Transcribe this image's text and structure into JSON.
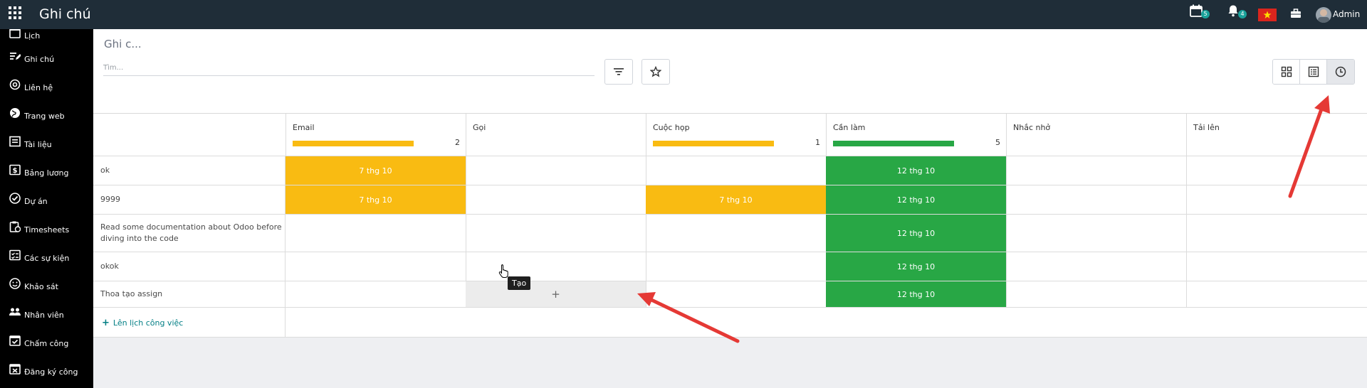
{
  "topbar": {
    "app_title": "Ghi chú",
    "activity_badge": "5",
    "notification_badge": "4",
    "user_name": "Admin"
  },
  "sidebar": {
    "items": [
      {
        "label": "Lịch",
        "icon": "calendar-icon"
      },
      {
        "label": "Ghi chú",
        "icon": "note-icon"
      },
      {
        "label": "Liên hệ",
        "icon": "at-icon"
      },
      {
        "label": "Trang web",
        "icon": "globe-icon"
      },
      {
        "label": "Tài liệu",
        "icon": "document-icon"
      },
      {
        "label": "Bảng lương",
        "icon": "payroll-icon"
      },
      {
        "label": "Dự án",
        "icon": "project-icon"
      },
      {
        "label": "Timesheets",
        "icon": "timesheet-icon"
      },
      {
        "label": "Các sự kiện",
        "icon": "events-icon"
      },
      {
        "label": "Khảo sát",
        "icon": "survey-icon"
      },
      {
        "label": "Nhân viên",
        "icon": "employees-icon"
      },
      {
        "label": "Chấm công",
        "icon": "attendance-icon"
      },
      {
        "label": "Đăng ký công",
        "icon": "registration-icon"
      }
    ]
  },
  "control_panel": {
    "breadcrumb": "Ghi c...",
    "search_placeholder": "Tìm..."
  },
  "grid": {
    "columns": [
      {
        "label": "Email",
        "count": "2",
        "bar_fraction": 0.8,
        "bar_color": "#f9bb12"
      },
      {
        "label": "Gọi",
        "count": "",
        "bar_fraction": 0,
        "bar_color": ""
      },
      {
        "label": "Cuộc họp",
        "count": "1",
        "bar_fraction": 0.8,
        "bar_color": "#f9bb12"
      },
      {
        "label": "Cần làm",
        "count": "5",
        "bar_fraction": 0.8,
        "bar_color": "#28a745"
      },
      {
        "label": "Nhắc nhở",
        "count": "",
        "bar_fraction": 0,
        "bar_color": ""
      },
      {
        "label": "Tải lên",
        "count": "",
        "bar_fraction": 0,
        "bar_color": ""
      }
    ],
    "rows": [
      {
        "title": "ok",
        "cells": [
          "7 thg 10",
          "",
          "",
          "12 thg 10",
          "",
          ""
        ]
      },
      {
        "title": "9999",
        "cells": [
          "7 thg 10",
          "",
          "7 thg 10",
          "12 thg 10",
          "",
          ""
        ]
      },
      {
        "title": "Read some documentation about Odoo before diving into the code",
        "cells": [
          "",
          "",
          "",
          "12 thg 10",
          "",
          ""
        ]
      },
      {
        "title": "okok",
        "cells": [
          "",
          "",
          "",
          "12 thg 10",
          "",
          ""
        ]
      },
      {
        "title": "Thoa tạo assign",
        "cells": [
          "",
          "+",
          "",
          "12 thg 10",
          "",
          ""
        ]
      }
    ],
    "schedule_link": "Lên lịch công việc",
    "tooltip": "Tạo"
  },
  "colors": {
    "topbar": "#1f2d38",
    "sidebar": "#000000",
    "warning": "#f9bb12",
    "success": "#28a745",
    "link": "#017e84",
    "annotation_arrow": "#e53935"
  }
}
